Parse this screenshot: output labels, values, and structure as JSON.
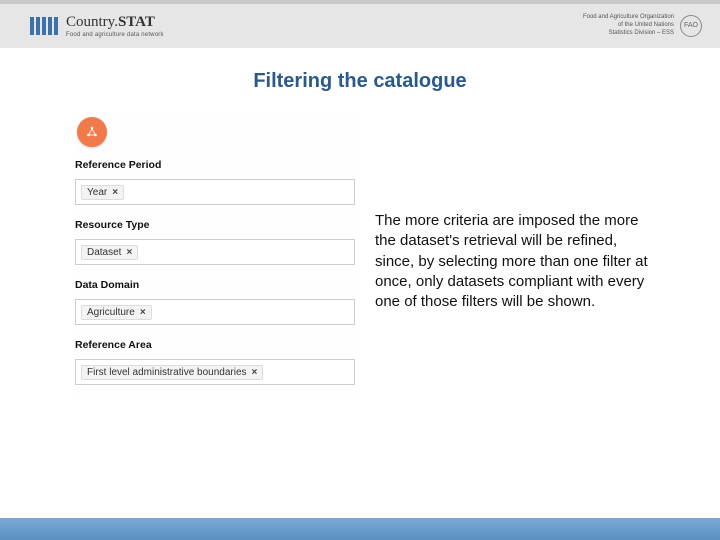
{
  "header": {
    "brand_main_a": "Country",
    "brand_main_b": "STAT",
    "brand_sub": "Food and agriculture data network",
    "org_line1": "Food and Agriculture Organization",
    "org_line2": "of the United Nations",
    "org_line3": "Statistics Division – ESS",
    "fao": "FAO"
  },
  "title": "Filtering the catalogue",
  "panel": {
    "fields": [
      {
        "label": "Reference Period",
        "tag": "Year"
      },
      {
        "label": "Resource Type",
        "tag": "Dataset"
      },
      {
        "label": "Data Domain",
        "tag": "Agriculture"
      },
      {
        "label": "Reference Area",
        "tag": "First level administrative boundaries"
      }
    ],
    "tag_close": "×"
  },
  "explain": "The more criteria are imposed the more the dataset's retrieval will be refined, since, by selecting more than one filter at once, only datasets compliant with every one of those filters will be shown."
}
